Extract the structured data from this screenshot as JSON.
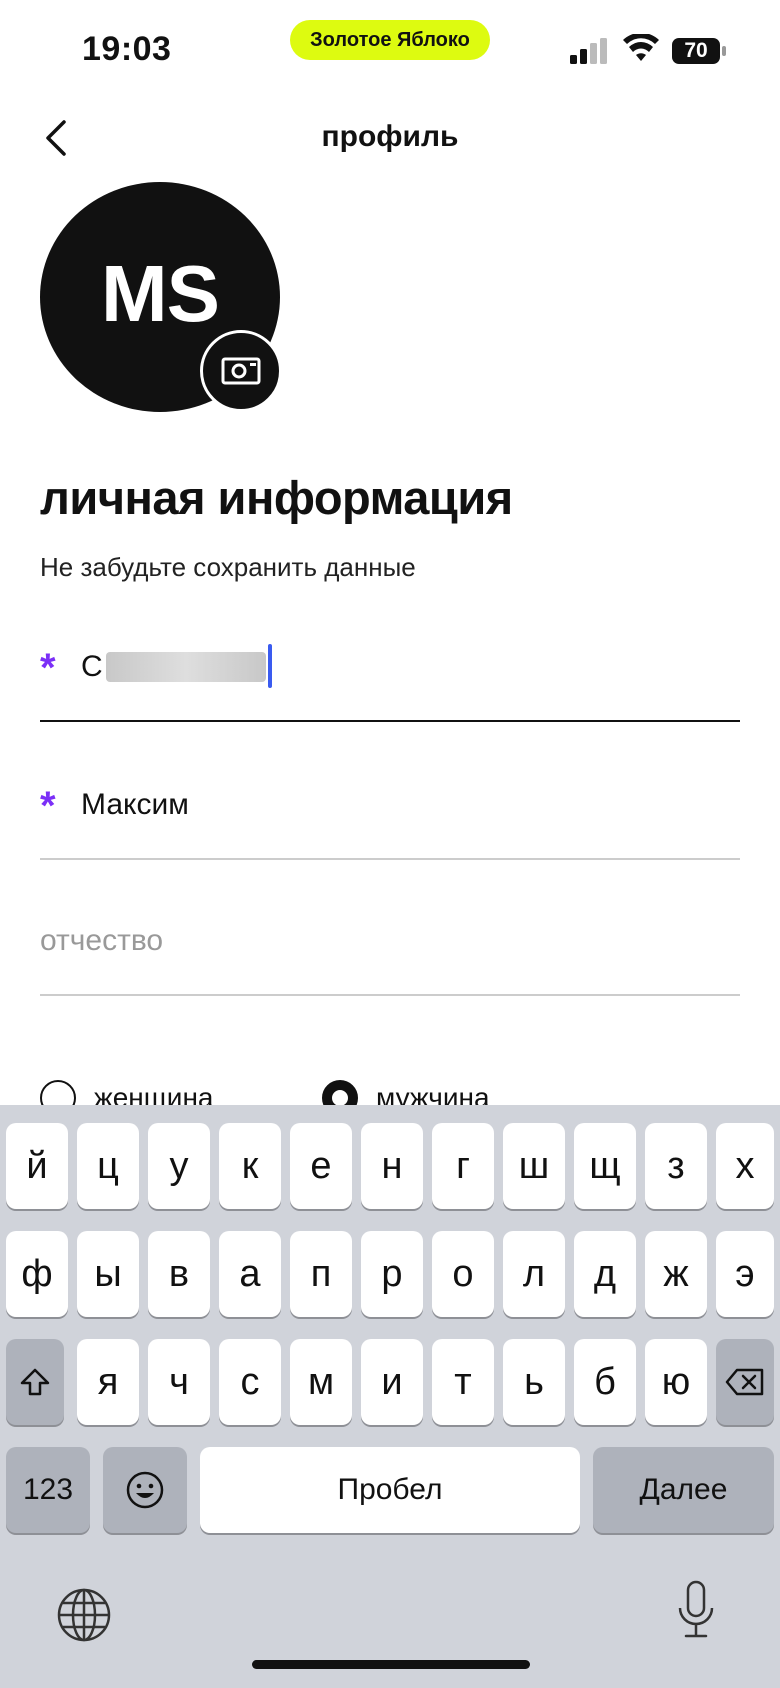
{
  "status_bar": {
    "time": "19:03",
    "carrier_pill": "Золотое Яблоко",
    "battery": "70",
    "pill_color": "#ddfb10"
  },
  "nav": {
    "title": "профиль",
    "back_icon": "chevron-left-icon"
  },
  "avatar": {
    "initials": "MS",
    "camera_icon": "camera-icon"
  },
  "section": {
    "title": "личная информация",
    "subtitle": "Не забудьте сохранить данные"
  },
  "form": {
    "required_mark": "*",
    "accent_color": "#7b2ff7",
    "last_name_value": "С",
    "first_name_value": "Максим",
    "patronymic_placeholder": "отчество"
  },
  "gender": {
    "female_label": "женщина",
    "male_label": "мужчина",
    "selected": "мужчина"
  },
  "keyboard": {
    "row1": [
      "й",
      "ц",
      "у",
      "к",
      "е",
      "н",
      "г",
      "ш",
      "щ",
      "з",
      "х"
    ],
    "row2": [
      "ф",
      "ы",
      "в",
      "а",
      "п",
      "р",
      "о",
      "л",
      "д",
      "ж",
      "э"
    ],
    "row3": [
      "я",
      "ч",
      "с",
      "м",
      "и",
      "т",
      "ь",
      "б",
      "ю"
    ],
    "numbers_key": "123",
    "space_key": "Пробел",
    "return_key": "Далее",
    "shift_icon": "shift-icon",
    "backspace_icon": "backspace-icon",
    "emoji_icon": "emoji-icon",
    "globe_icon": "globe-icon",
    "mic_icon": "microphone-icon"
  }
}
